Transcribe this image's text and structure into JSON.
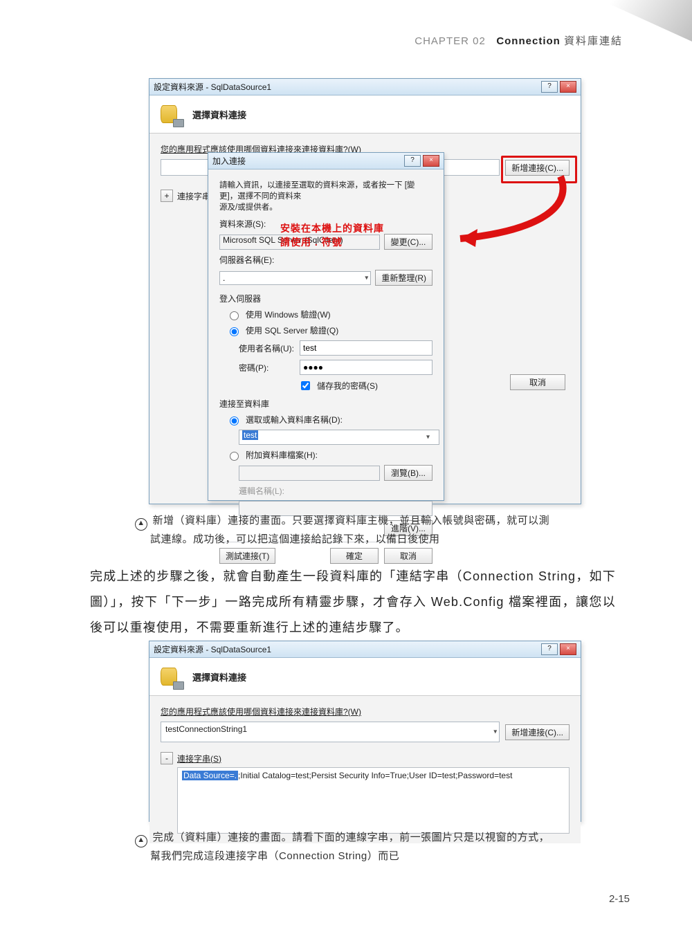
{
  "chapter": {
    "prefix": "CHAPTER 02",
    "title": "Connection",
    "zh": "資料庫連結"
  },
  "page_number": "2-15",
  "figA": {
    "bg_win_title": "設定資料來源 - SqlDataSource1",
    "bg_header": "選擇資料連接",
    "bg_prompt": "您的應用程式應該使用哪個資料連接來連接資料庫?(W)",
    "new_conn_btn": "新增連接(C)...",
    "expand_btn": "+",
    "conn_str_label_stub": "連接字串(S",
    "bg_cancel": "取消",
    "dlg_title": "加入連接",
    "dlg_intro1": "請輸入資訊，以連接至選取的資料來源，或者按一下 [變更]，選擇不同的資料來",
    "dlg_intro2": "源及/或提供者。",
    "ds_label": "資料來源(S):",
    "ds_value": "Microsoft SQL Server (SqlClient)",
    "change_btn": "變更(C)...",
    "server_label": "伺服器名稱(E):",
    "server_value": ".",
    "refresh_btn": "重新整理(R)",
    "login_group": "登入伺服器",
    "win_auth": "使用 Windows 驗證(W)",
    "sql_auth": "使用 SQL Server 驗證(Q)",
    "user_label": "使用者名稱(U):",
    "user_value": "test",
    "pwd_label": "密碼(P):",
    "pwd_value": "●●●●",
    "save_pwd": "儲存我的密碼(S)",
    "conn_db_group": "連接至資料庫",
    "db_select_radio": "選取或輸入資料庫名稱(D):",
    "db_select_value": "test",
    "attach_radio": "附加資料庫檔案(H):",
    "browse_btn": "瀏覽(B)...",
    "logical_name": "邏輯名稱(L):",
    "advanced_btn": "進階(V)...",
    "test_btn": "測試連接(T)",
    "ok_btn": "確定",
    "cancel_btn": "取消",
    "annot1": "安裝在本機上的資料庫",
    "annot2": "請使用 . 符號"
  },
  "captionA": {
    "line1": "新增（資料庫）連接的畫面。只要選擇資料庫主機，並且輸入帳號與密碼，就可以測",
    "line2": "試連線。成功後，可以把這個連接給記錄下來，以備日後使用"
  },
  "paragraph": {
    "text": "完成上述的步驟之後，就會自動產生一段資料庫的「連結字串（Connection String，如下圖）」，按下「下一步」一路完成所有精靈步驟，才會存入 Web.Config 檔案裡面，讓您以後可以重複使用，不需要重新進行上述的連結步驟了。"
  },
  "figB": {
    "win_title": "設定資料來源 - SqlDataSource1",
    "header": "選擇資料連接",
    "prompt": "您的應用程式應該使用哪個資料連接來連接資料庫?(W)",
    "conn_name": "testConnectionString1",
    "new_conn_btn": "新增連接(C)...",
    "expand_btn": "-",
    "conn_str_label": "連接字串(S)",
    "conn_str_prefix": "Data Source=.",
    "conn_str_rest": ";Initial Catalog=test;Persist Security Info=True;User ID=test;Password=test"
  },
  "captionB": {
    "line1": "完成（資料庫）連接的畫面。請看下面的連線字串，前一張圖片只是以視窗的方式，",
    "line2": "幫我們完成這段連接字串（Connection String）而已"
  }
}
